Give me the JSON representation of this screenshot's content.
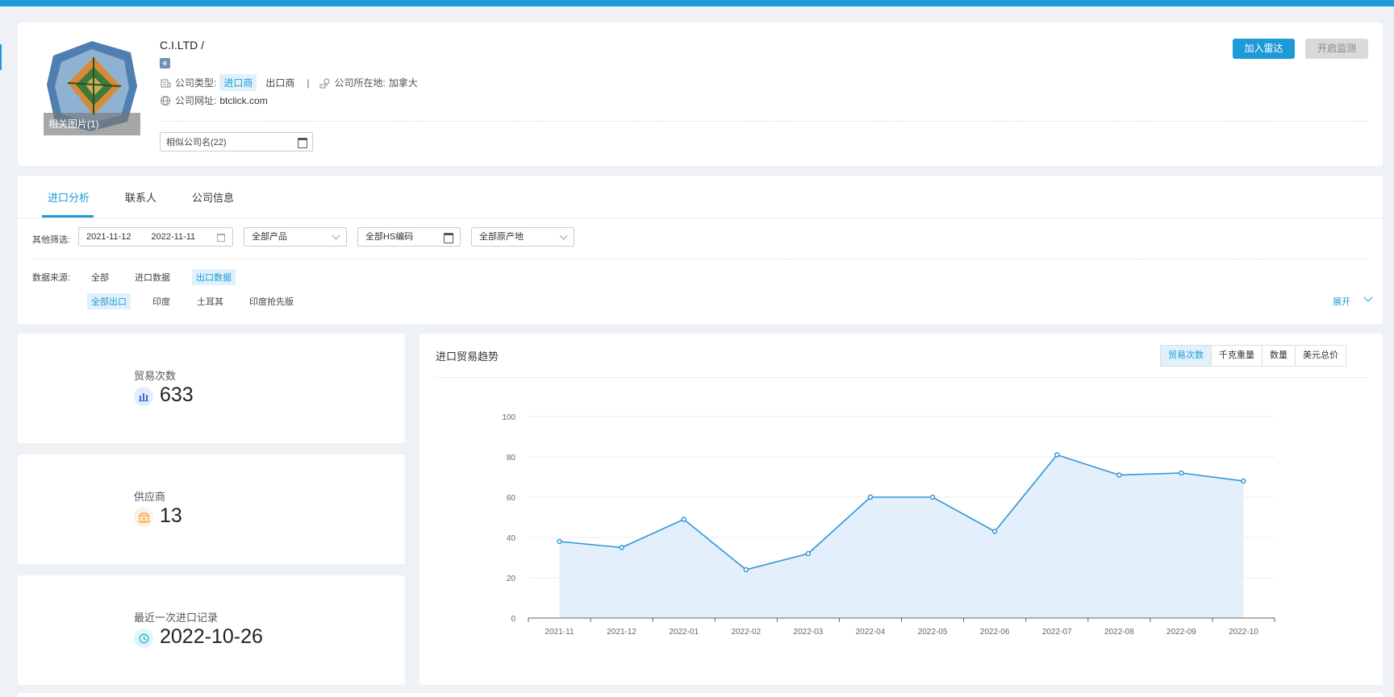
{
  "company": {
    "logo_caption": "相关图片(1)",
    "name": "C.I.LTD /",
    "type_label": "公司类型:",
    "type_options": [
      "进口商",
      "出口商"
    ],
    "type_selected": "进口商",
    "location_label": "公司所在地:",
    "location_value": "加拿大",
    "website_label": "公司网址:",
    "website_value": "btclick.com",
    "similar_label": "相似公司名(22)",
    "btn_radar": "加入雷达",
    "btn_monitor": "开启监测"
  },
  "tabs": [
    "进口分析",
    "联系人",
    "公司信息"
  ],
  "active_tab": "进口分析",
  "filters": {
    "label": "其他筛选:",
    "date_start": "2021-11-12",
    "date_end": "2022-11-11",
    "product": "全部产品",
    "hs_code": "全部HS编码",
    "origin": "全部原产地"
  },
  "data_source": {
    "label": "数据来源:",
    "options": [
      "全部",
      "进口数据",
      "出口数据"
    ],
    "selected": "出口数据",
    "sub_options": [
      "全部出口",
      "印度",
      "土耳其",
      "印度抢先版"
    ],
    "sub_selected": "全部出口",
    "expand": "展开"
  },
  "stats": [
    {
      "label": "贸易次数",
      "value": "633",
      "icon": "bar-chart-icon",
      "color": "#3b6fd6",
      "bg": "#e4ecfb"
    },
    {
      "label": "供应商",
      "value": "13",
      "icon": "supplier-icon",
      "color": "#f0a43a",
      "bg": "#fdf1e0"
    },
    {
      "label": "最近一次进口记录",
      "value": "2022-10-26",
      "icon": "clock-icon",
      "color": "#27b3c8",
      "bg": "#e0f5f8"
    }
  ],
  "chart": {
    "title": "进口贸易趋势",
    "metric_tabs": [
      "贸易次数",
      "千克重量",
      "数量",
      "美元总价"
    ],
    "metric_selected": "贸易次数"
  },
  "chart_data": {
    "type": "area",
    "categories": [
      "2021-11",
      "2021-12",
      "2022-01",
      "2022-02",
      "2022-03",
      "2022-04",
      "2022-05",
      "2022-06",
      "2022-07",
      "2022-08",
      "2022-09",
      "2022-10"
    ],
    "values": [
      38,
      35,
      49,
      24,
      32,
      60,
      60,
      43,
      81,
      71,
      72,
      68
    ],
    "ylim": [
      0,
      100
    ],
    "yticks": [
      0,
      20,
      40,
      60,
      80,
      100
    ],
    "grid": true,
    "line_color": "#2e95d8",
    "fill_color": "#e3effb"
  }
}
